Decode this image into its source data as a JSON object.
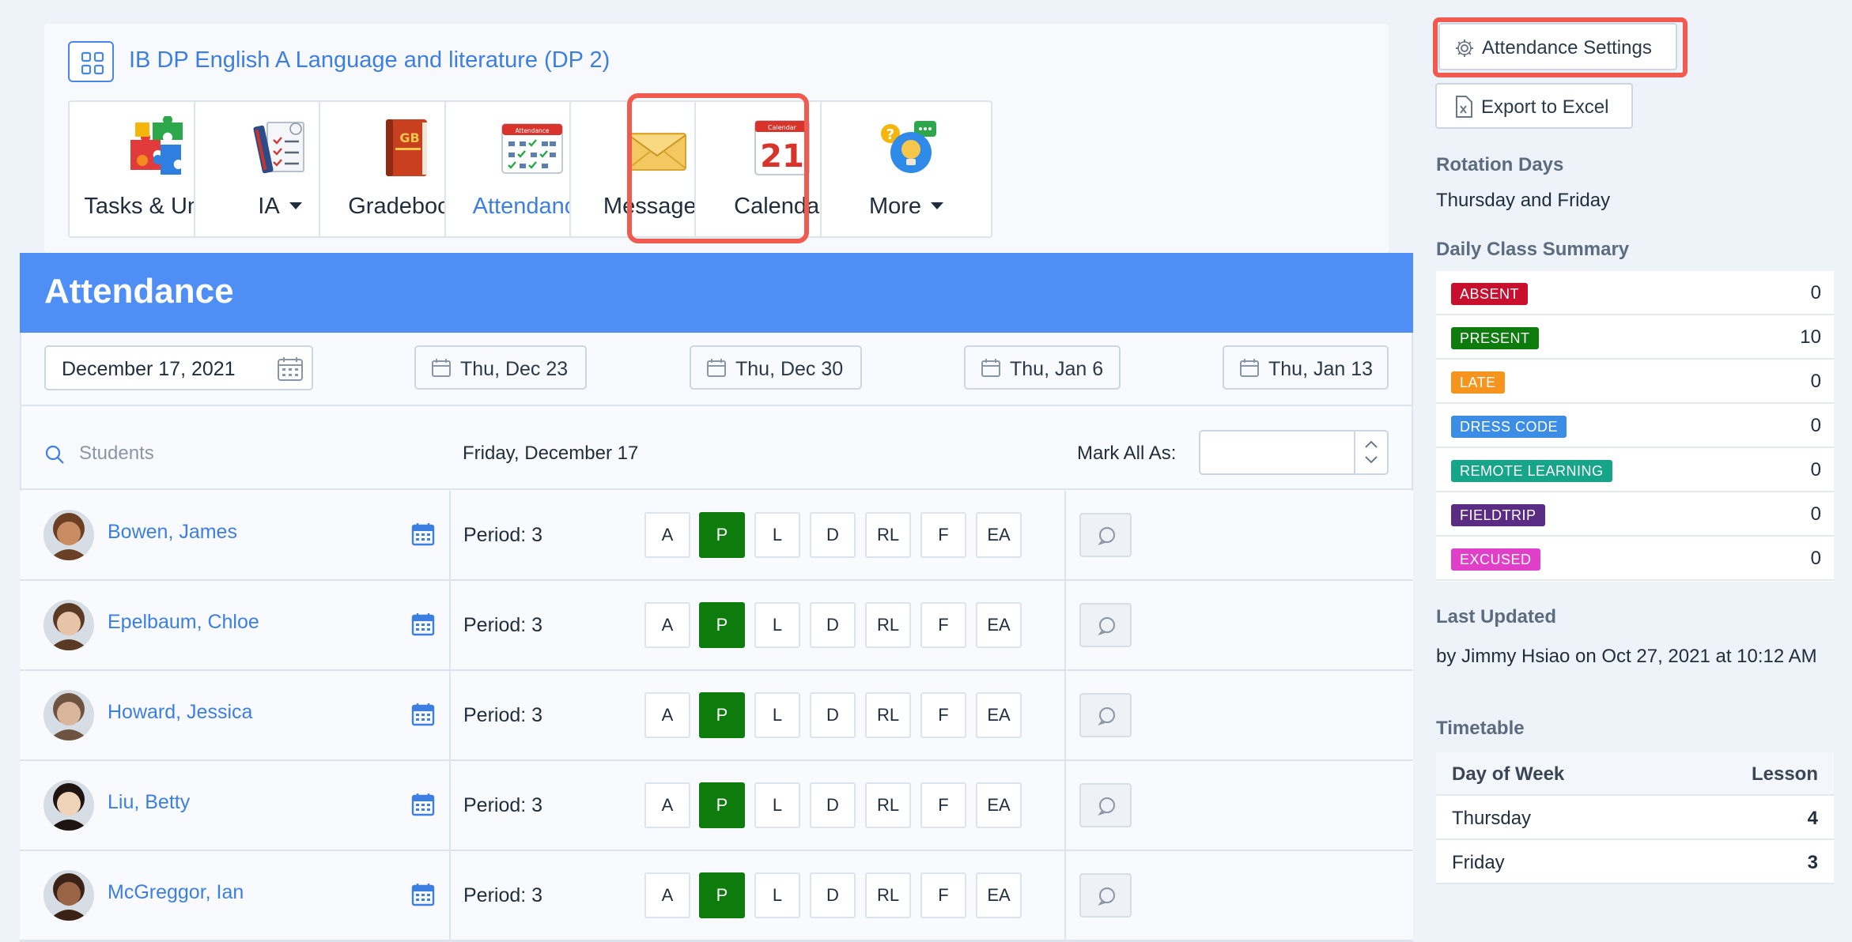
{
  "course": {
    "title": "IB DP English A Language and literature (DP 2)"
  },
  "tiles": [
    {
      "label": "Tasks & Uni...",
      "icon": "puzzle-icon",
      "dropdown": false
    },
    {
      "label": "IA",
      "icon": "ia-checklist-icon",
      "dropdown": true
    },
    {
      "label": "Gradebook",
      "icon": "gradebook-book-icon",
      "dropdown": false
    },
    {
      "label": "Attendance",
      "icon": "attendance-calendar-icon",
      "dropdown": false,
      "active": true
    },
    {
      "label": "Messages",
      "icon": "envelope-icon",
      "dropdown": false
    },
    {
      "label": "Calendar",
      "icon": "calendar-21-icon",
      "dropdown": false
    },
    {
      "label": "More",
      "icon": "more-lightbulb-icon",
      "dropdown": true
    }
  ],
  "icon_text": {
    "gradebook": "GB",
    "attendance": "Attendance",
    "calendar_top": "Calendar",
    "calendar_day": "21"
  },
  "attendance": {
    "title": "Attendance",
    "selected_date": "December 17, 2021",
    "upcoming_dates": [
      "Thu, Dec 23",
      "Thu, Dec 30",
      "Thu, Jan 6",
      "Thu, Jan 13"
    ],
    "search_placeholder": "Students",
    "day_label": "Friday, December 17",
    "mark_all_label": "Mark All As:",
    "mark_all_value": "",
    "status_buttons": [
      "A",
      "P",
      "L",
      "D",
      "RL",
      "F",
      "EA"
    ],
    "students": [
      {
        "name": "Bowen, James",
        "period": "Period: 3",
        "status": "P"
      },
      {
        "name": "Epelbaum, Chloe",
        "period": "Period: 3",
        "status": "P"
      },
      {
        "name": "Howard, Jessica",
        "period": "Period: 3",
        "status": "P"
      },
      {
        "name": "Liu, Betty",
        "period": "Period: 3",
        "status": "P"
      },
      {
        "name": "McGreggor, Ian",
        "period": "Period: 3",
        "status": "P"
      }
    ]
  },
  "sidebar": {
    "settings_label": "Attendance Settings",
    "export_label": "Export to Excel",
    "rotation_title": "Rotation Days",
    "rotation_value": "Thursday and Friday",
    "summary_title": "Daily Class Summary",
    "summary": [
      {
        "label": "ABSENT",
        "count": "0",
        "color": "#c8102e"
      },
      {
        "label": "PRESENT",
        "count": "10",
        "color": "#0d7c0d"
      },
      {
        "label": "LATE",
        "count": "0",
        "color": "#f7941d"
      },
      {
        "label": "DRESS CODE",
        "count": "0",
        "color": "#3b8de6"
      },
      {
        "label": "REMOTE LEARNING",
        "count": "0",
        "color": "#17a589"
      },
      {
        "label": "FIELDTRIP",
        "count": "0",
        "color": "#5b2c83"
      },
      {
        "label": "EXCUSED",
        "count": "0",
        "color": "#e040c8"
      }
    ],
    "last_updated_title": "Last Updated",
    "last_updated_value": "by Jimmy Hsiao on Oct 27, 2021 at 10:12 AM",
    "timetable_title": "Timetable",
    "timetable_headers": [
      "Day of Week",
      "Lesson"
    ],
    "timetable_rows": [
      {
        "day": "Thursday",
        "lesson": "4"
      },
      {
        "day": "Friday",
        "lesson": "3"
      }
    ]
  },
  "colors": {
    "accent": "#4f8ef4",
    "link": "#3d7fe0",
    "highlight": "#f05a4f",
    "present": "#0d7c0d"
  }
}
